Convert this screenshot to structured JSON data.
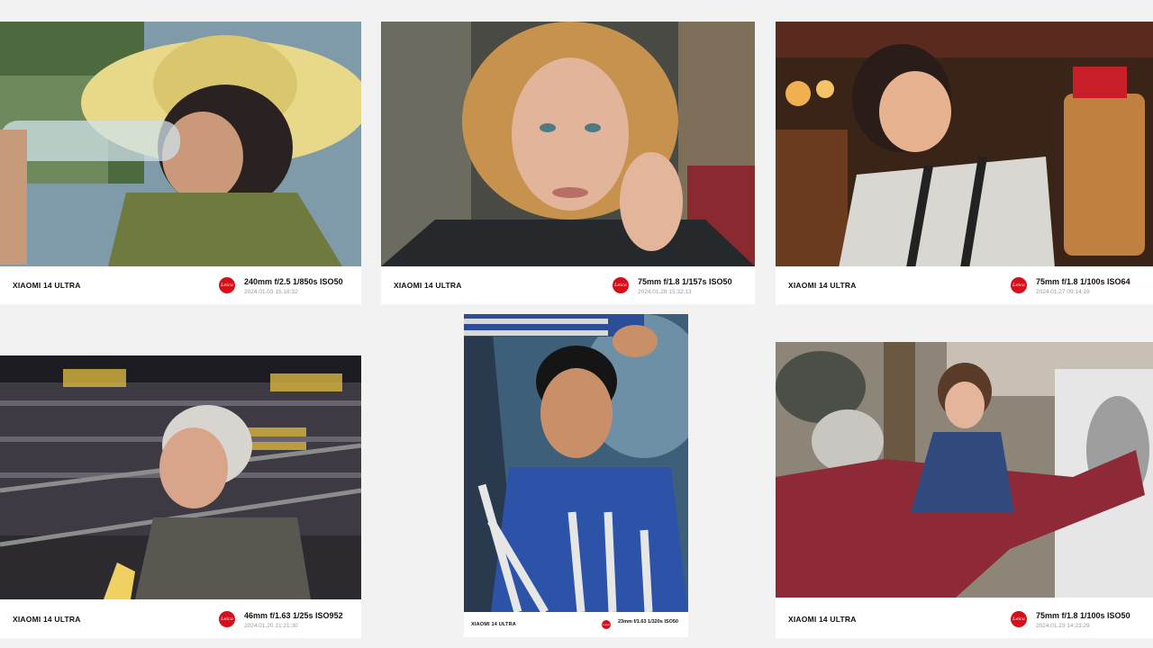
{
  "photos": [
    {
      "model": "XIAOMI 14 ULTRA",
      "exif": "240mm  f/2.5  1/850s  ISO50",
      "timestamp": "2024.01.03  15:18:32",
      "brand_mark": "Leica",
      "subject": "child in straw hat drinking from bottle"
    },
    {
      "model": "XIAOMI 14 ULTRA",
      "exif": "75mm  f/1.8  1/157s  ISO50",
      "timestamp": "2024.01.28  15:32:13",
      "brand_mark": "Leica",
      "subject": "curly-haired woman portrait"
    },
    {
      "model": "XIAOMI 14 ULTRA",
      "exif": "75mm  f/1.8  1/100s  ISO64",
      "timestamp": "2024.01.27  09:14:19",
      "brand_mark": "Leica",
      "subject": "smiling girl with candy jar"
    },
    {
      "model": "XIAOMI 14 ULTRA",
      "exif": "46mm  f/1.63  1/25s  ISO952",
      "timestamp": "2024.01.20  21:21:30",
      "brand_mark": "Leica",
      "subject": "older man eating banana in stadium"
    },
    {
      "model": "XIAOMI 14 ULTRA",
      "exif": "23mm  f/1.63  1/320s  ISO50",
      "timestamp": "",
      "brand_mark": "Leica",
      "subject": "boy in striped sweater"
    },
    {
      "model": "XIAOMI 14 ULTRA",
      "exif": "75mm  f/1.8  1/100s  ISO50",
      "timestamp": "2024.01.23  14:23:29",
      "brand_mark": "Leica",
      "subject": "girl watching street artist sketch"
    }
  ]
}
